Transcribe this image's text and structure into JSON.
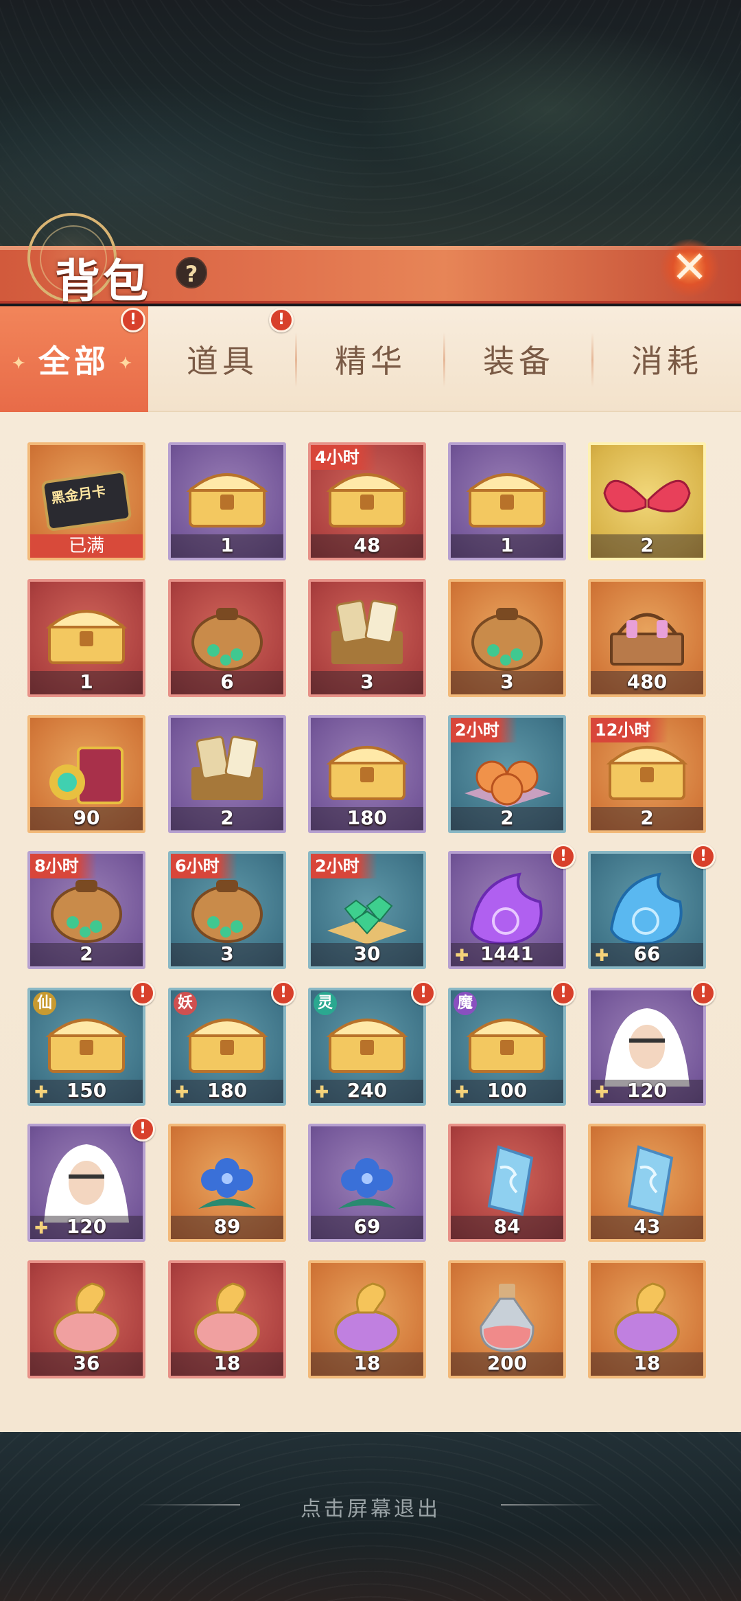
{
  "header": {
    "title": "背包",
    "help_label": "?",
    "close_label": "✕"
  },
  "tabs": [
    {
      "label": "全部",
      "active": true,
      "alert": true
    },
    {
      "label": "道具",
      "active": false,
      "alert": true
    },
    {
      "label": "精华",
      "active": false,
      "alert": false
    },
    {
      "label": "装备",
      "active": false,
      "alert": false
    },
    {
      "label": "消耗",
      "active": false,
      "alert": false
    }
  ],
  "alert_mark": "!",
  "items": [
    {
      "name": "black-gold-month-card",
      "frame": "orange",
      "label": "已满",
      "card_text": "黑金月卡",
      "icon": "card-icon"
    },
    {
      "name": "golden-chest",
      "frame": "purple",
      "count": "1",
      "icon": "chest-icon"
    },
    {
      "name": "orb-chest",
      "frame": "red",
      "count": "48",
      "timer": "4小时",
      "icon": "chest-icon"
    },
    {
      "name": "jade-chest",
      "frame": "purple",
      "count": "1",
      "icon": "chest-icon"
    },
    {
      "name": "wing-ornament",
      "frame": "gold",
      "count": "2",
      "icon": "wings-icon"
    },
    {
      "name": "red-card-chest",
      "frame": "red",
      "count": "1",
      "icon": "chest-icon"
    },
    {
      "name": "blue-bag",
      "frame": "red",
      "count": "6",
      "icon": "bag-icon"
    },
    {
      "name": "card-box",
      "frame": "red",
      "count": "3",
      "icon": "box-icon"
    },
    {
      "name": "lucky-bag",
      "frame": "orange",
      "count": "3",
      "icon": "bag-icon"
    },
    {
      "name": "potion-basket",
      "frame": "orange",
      "count": "480",
      "icon": "basket-icon"
    },
    {
      "name": "potion-book",
      "frame": "orange",
      "count": "90",
      "icon": "book-icon"
    },
    {
      "name": "purple-card-box",
      "frame": "purple",
      "count": "2",
      "icon": "box-icon"
    },
    {
      "name": "rainbow-chest",
      "frame": "purple",
      "count": "180",
      "icon": "chest-icon"
    },
    {
      "name": "orb-pile",
      "frame": "blue",
      "count": "2",
      "timer": "2小时",
      "icon": "orb-icon"
    },
    {
      "name": "gem-chest",
      "frame": "orange",
      "count": "2",
      "timer": "12小时",
      "icon": "chest-icon"
    },
    {
      "name": "gem-bags-large",
      "frame": "purple",
      "count": "2",
      "timer": "8小时",
      "icon": "bag-icon"
    },
    {
      "name": "gem-bag",
      "frame": "blue",
      "count": "3",
      "timer": "6小时",
      "icon": "bag-icon"
    },
    {
      "name": "gem-pile",
      "frame": "blue",
      "count": "30",
      "timer": "2小时",
      "icon": "gem-icon"
    },
    {
      "name": "purple-flame",
      "frame": "purple",
      "count": "1441",
      "puzzle": true,
      "alert": true,
      "icon": "flame-icon"
    },
    {
      "name": "blue-flame",
      "frame": "blue",
      "count": "66",
      "puzzle": true,
      "alert": true,
      "icon": "flame-icon"
    },
    {
      "name": "immortal-chest",
      "frame": "blue",
      "count": "150",
      "race": "仙",
      "puzzle": true,
      "alert": true,
      "icon": "chest-icon"
    },
    {
      "name": "demon-chest",
      "frame": "blue",
      "count": "180",
      "race": "妖",
      "puzzle": true,
      "alert": true,
      "icon": "chest-icon"
    },
    {
      "name": "spirit-chest",
      "frame": "blue",
      "count": "240",
      "race": "灵",
      "puzzle": true,
      "alert": true,
      "icon": "chest-icon"
    },
    {
      "name": "devil-chest",
      "frame": "blue",
      "count": "100",
      "race": "魔",
      "puzzle": true,
      "alert": true,
      "icon": "chest-icon"
    },
    {
      "name": "hero-shard-white-demon",
      "frame": "purple",
      "count": "120",
      "puzzle": true,
      "alert": true,
      "icon": "portrait-icon"
    },
    {
      "name": "hero-shard-white-sage",
      "frame": "purple",
      "count": "120",
      "puzzle": true,
      "alert": true,
      "icon": "portrait-icon"
    },
    {
      "name": "blue-flower-orange",
      "frame": "orange",
      "count": "89",
      "icon": "flower-icon"
    },
    {
      "name": "blue-flower-purple",
      "frame": "purple",
      "count": "69",
      "icon": "flower-icon"
    },
    {
      "name": "crystal-red",
      "frame": "red",
      "count": "84",
      "icon": "crystal-icon"
    },
    {
      "name": "crystal-orange",
      "frame": "orange",
      "count": "43",
      "icon": "crystal-icon"
    },
    {
      "name": "pink-elixir",
      "frame": "red",
      "count": "36",
      "icon": "elixir-icon"
    },
    {
      "name": "green-elixir",
      "frame": "red",
      "count": "18",
      "icon": "elixir-icon"
    },
    {
      "name": "purple-elixir",
      "frame": "orange",
      "count": "18",
      "icon": "elixir-icon"
    },
    {
      "name": "pink-potion-bottle",
      "frame": "orange",
      "count": "200",
      "icon": "bottle-icon"
    },
    {
      "name": "gold-elixir",
      "frame": "orange",
      "count": "18",
      "icon": "elixir-icon"
    }
  ],
  "footer": {
    "exit_hint": "点击屏幕退出"
  },
  "colors": {
    "accent": "#e86b48",
    "alert": "#d8402b",
    "timer": "#d8463a",
    "panel": "#f6ead9"
  }
}
